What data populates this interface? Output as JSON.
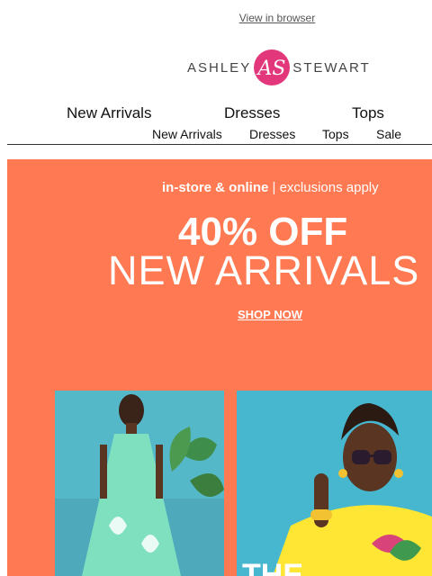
{
  "header": {
    "view_in_browser": "View in browser",
    "logo_left": "ASHLEY",
    "logo_right": "STEWART",
    "logo_mark_letters": "AS"
  },
  "nav_primary": [
    "New Arrivals",
    "Dresses",
    "Tops"
  ],
  "nav_secondary": [
    "New Arrivals",
    "Dresses",
    "Tops",
    "Sale"
  ],
  "banner": {
    "tag_bold": "in-store & online",
    "tag_rest": " | exclusions apply",
    "discount": "40% OFF",
    "headline": "NEW ARRIVALS",
    "cta": "SHOP NOW",
    "photo_right_caption": "THE",
    "bg_color": "#ff7a52"
  },
  "colors": {
    "brand_pink": "#e2377b",
    "text": "#111111"
  }
}
